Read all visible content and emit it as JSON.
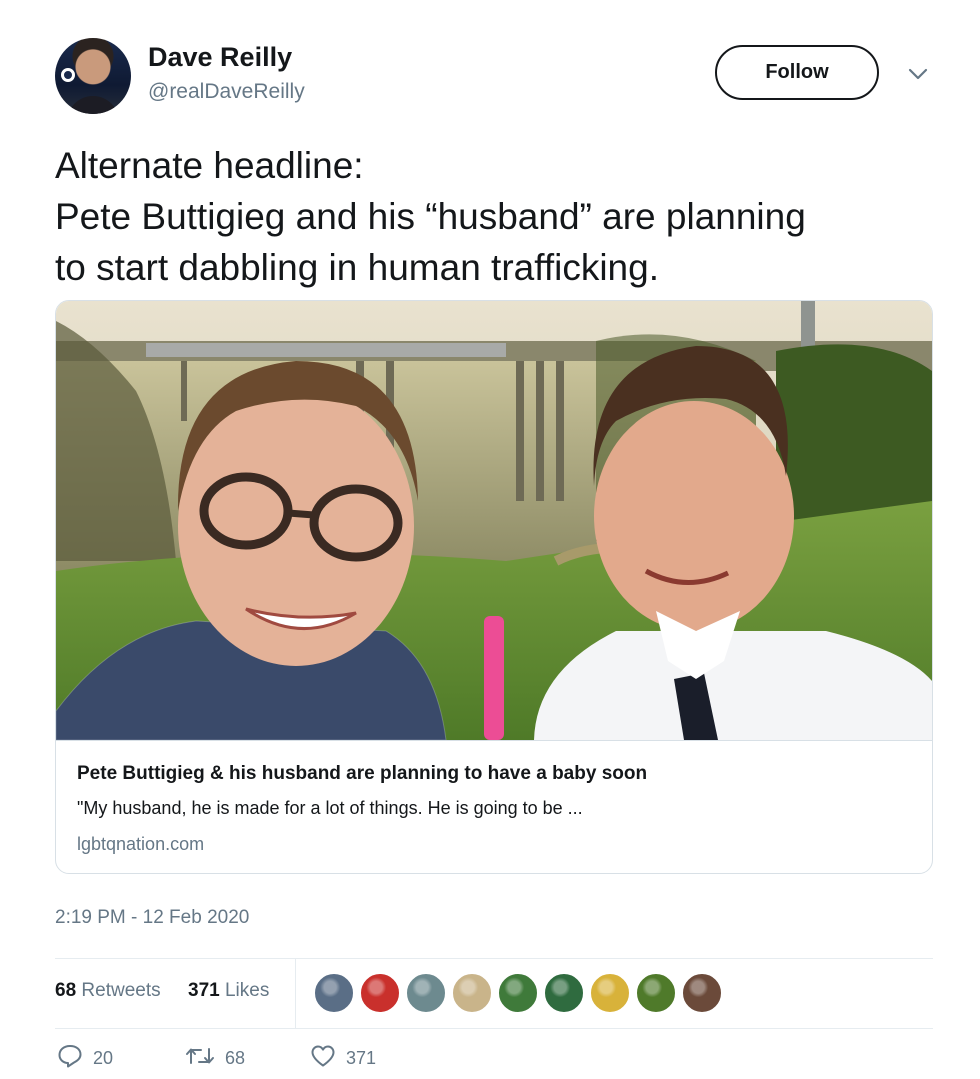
{
  "author": {
    "display_name": "Dave Reilly",
    "handle": "@realDaveReilly",
    "avatar_icon": "user-avatar"
  },
  "follow_label": "Follow",
  "tweet": {
    "lines": [
      "Alternate headline:",
      "Pete Buttigieg and his “husband” are planning",
      "to start dabbling in human trafficking."
    ]
  },
  "card": {
    "title": "Pete Buttigieg & his husband are planning to have a baby soon",
    "description": "\"My husband, he is made for a lot of things. He is going to be ...",
    "domain": "lgbtqnation.com"
  },
  "timestamp": "2:19 PM - 12 Feb 2020",
  "stats": {
    "retweets_count": "68",
    "retweets_label": "Retweets",
    "likes_count": "371",
    "likes_label": "Likes"
  },
  "liker_avatar_colors": [
    "#5a6e86",
    "#c9302c",
    "#6d8a8f",
    "#c9b48a",
    "#3f7a3a",
    "#2f6b3f",
    "#d8b23a",
    "#4f7a2a",
    "#6b4a3a"
  ],
  "actions": {
    "reply_count": "20",
    "retweet_count": "68",
    "like_count": "371"
  },
  "colors": {
    "text": "#14171a",
    "secondary": "#657786",
    "border": "#d8e0e6"
  }
}
